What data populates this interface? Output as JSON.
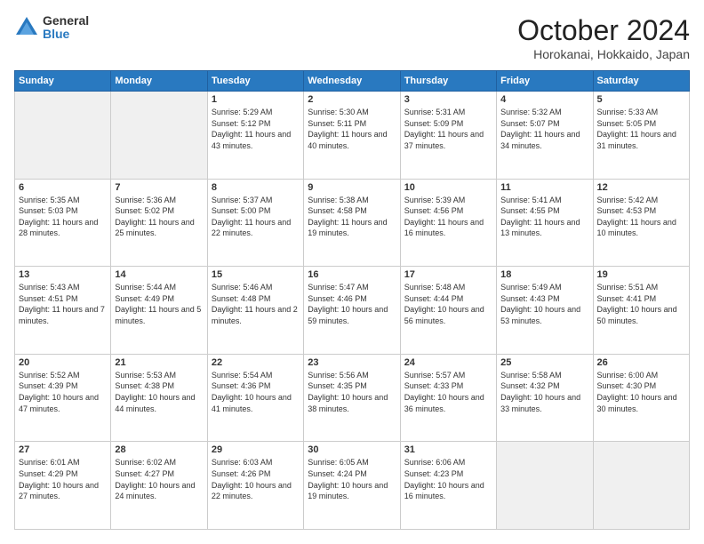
{
  "header": {
    "logo": {
      "general": "General",
      "blue": "Blue"
    },
    "title": "October 2024",
    "location": "Horokanai, Hokkaido, Japan"
  },
  "weekdays": [
    "Sunday",
    "Monday",
    "Tuesday",
    "Wednesday",
    "Thursday",
    "Friday",
    "Saturday"
  ],
  "weeks": [
    [
      {
        "day": "",
        "info": ""
      },
      {
        "day": "",
        "info": ""
      },
      {
        "day": "1",
        "info": "Sunrise: 5:29 AM\nSunset: 5:12 PM\nDaylight: 11 hours and 43 minutes."
      },
      {
        "day": "2",
        "info": "Sunrise: 5:30 AM\nSunset: 5:11 PM\nDaylight: 11 hours and 40 minutes."
      },
      {
        "day": "3",
        "info": "Sunrise: 5:31 AM\nSunset: 5:09 PM\nDaylight: 11 hours and 37 minutes."
      },
      {
        "day": "4",
        "info": "Sunrise: 5:32 AM\nSunset: 5:07 PM\nDaylight: 11 hours and 34 minutes."
      },
      {
        "day": "5",
        "info": "Sunrise: 5:33 AM\nSunset: 5:05 PM\nDaylight: 11 hours and 31 minutes."
      }
    ],
    [
      {
        "day": "6",
        "info": "Sunrise: 5:35 AM\nSunset: 5:03 PM\nDaylight: 11 hours and 28 minutes."
      },
      {
        "day": "7",
        "info": "Sunrise: 5:36 AM\nSunset: 5:02 PM\nDaylight: 11 hours and 25 minutes."
      },
      {
        "day": "8",
        "info": "Sunrise: 5:37 AM\nSunset: 5:00 PM\nDaylight: 11 hours and 22 minutes."
      },
      {
        "day": "9",
        "info": "Sunrise: 5:38 AM\nSunset: 4:58 PM\nDaylight: 11 hours and 19 minutes."
      },
      {
        "day": "10",
        "info": "Sunrise: 5:39 AM\nSunset: 4:56 PM\nDaylight: 11 hours and 16 minutes."
      },
      {
        "day": "11",
        "info": "Sunrise: 5:41 AM\nSunset: 4:55 PM\nDaylight: 11 hours and 13 minutes."
      },
      {
        "day": "12",
        "info": "Sunrise: 5:42 AM\nSunset: 4:53 PM\nDaylight: 11 hours and 10 minutes."
      }
    ],
    [
      {
        "day": "13",
        "info": "Sunrise: 5:43 AM\nSunset: 4:51 PM\nDaylight: 11 hours and 7 minutes."
      },
      {
        "day": "14",
        "info": "Sunrise: 5:44 AM\nSunset: 4:49 PM\nDaylight: 11 hours and 5 minutes."
      },
      {
        "day": "15",
        "info": "Sunrise: 5:46 AM\nSunset: 4:48 PM\nDaylight: 11 hours and 2 minutes."
      },
      {
        "day": "16",
        "info": "Sunrise: 5:47 AM\nSunset: 4:46 PM\nDaylight: 10 hours and 59 minutes."
      },
      {
        "day": "17",
        "info": "Sunrise: 5:48 AM\nSunset: 4:44 PM\nDaylight: 10 hours and 56 minutes."
      },
      {
        "day": "18",
        "info": "Sunrise: 5:49 AM\nSunset: 4:43 PM\nDaylight: 10 hours and 53 minutes."
      },
      {
        "day": "19",
        "info": "Sunrise: 5:51 AM\nSunset: 4:41 PM\nDaylight: 10 hours and 50 minutes."
      }
    ],
    [
      {
        "day": "20",
        "info": "Sunrise: 5:52 AM\nSunset: 4:39 PM\nDaylight: 10 hours and 47 minutes."
      },
      {
        "day": "21",
        "info": "Sunrise: 5:53 AM\nSunset: 4:38 PM\nDaylight: 10 hours and 44 minutes."
      },
      {
        "day": "22",
        "info": "Sunrise: 5:54 AM\nSunset: 4:36 PM\nDaylight: 10 hours and 41 minutes."
      },
      {
        "day": "23",
        "info": "Sunrise: 5:56 AM\nSunset: 4:35 PM\nDaylight: 10 hours and 38 minutes."
      },
      {
        "day": "24",
        "info": "Sunrise: 5:57 AM\nSunset: 4:33 PM\nDaylight: 10 hours and 36 minutes."
      },
      {
        "day": "25",
        "info": "Sunrise: 5:58 AM\nSunset: 4:32 PM\nDaylight: 10 hours and 33 minutes."
      },
      {
        "day": "26",
        "info": "Sunrise: 6:00 AM\nSunset: 4:30 PM\nDaylight: 10 hours and 30 minutes."
      }
    ],
    [
      {
        "day": "27",
        "info": "Sunrise: 6:01 AM\nSunset: 4:29 PM\nDaylight: 10 hours and 27 minutes."
      },
      {
        "day": "28",
        "info": "Sunrise: 6:02 AM\nSunset: 4:27 PM\nDaylight: 10 hours and 24 minutes."
      },
      {
        "day": "29",
        "info": "Sunrise: 6:03 AM\nSunset: 4:26 PM\nDaylight: 10 hours and 22 minutes."
      },
      {
        "day": "30",
        "info": "Sunrise: 6:05 AM\nSunset: 4:24 PM\nDaylight: 10 hours and 19 minutes."
      },
      {
        "day": "31",
        "info": "Sunrise: 6:06 AM\nSunset: 4:23 PM\nDaylight: 10 hours and 16 minutes."
      },
      {
        "day": "",
        "info": ""
      },
      {
        "day": "",
        "info": ""
      }
    ]
  ]
}
